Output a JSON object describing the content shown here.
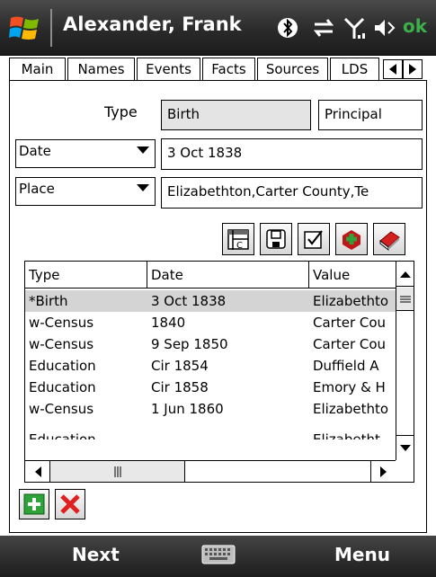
{
  "title_bar": {
    "title": "Alexander, Frank",
    "ok_label": "ok",
    "status_icons": [
      "bluetooth-icon",
      "data-sync-icon",
      "signal-icon",
      "volume-icon"
    ]
  },
  "tabs": [
    {
      "label": "Main"
    },
    {
      "label": "Names"
    },
    {
      "label": "Events",
      "active": true
    },
    {
      "label": "Facts"
    },
    {
      "label": "Sources"
    },
    {
      "label": "LDS"
    }
  ],
  "event_form": {
    "type_label": "Type",
    "type_value": "Birth",
    "role_value": "Principal",
    "date_selector": "Date",
    "date_value": "3 Oct 1838",
    "place_selector": "Place",
    "place_value": "Elizabethton,Carter County,Te"
  },
  "toolbar_icons": [
    "calendar-edit-icon",
    "save-icon",
    "checkbox-icon",
    "add-source-icon",
    "book-icon"
  ],
  "events_list": {
    "columns": [
      "Type",
      "Date",
      "Value"
    ],
    "rows": [
      {
        "type": "*Birth",
        "date": "3 Oct 1838",
        "value": "Elizabethto",
        "selected": true
      },
      {
        "type": "w-Census",
        "date": "1840",
        "value": "Carter Cou"
      },
      {
        "type": "w-Census",
        "date": "9 Sep 1850",
        "value": "Carter Cou"
      },
      {
        "type": "Education",
        "date": "Cir 1854",
        "value": "Duffield A"
      },
      {
        "type": "Education",
        "date": "Cir 1858",
        "value": "Emory & H"
      },
      {
        "type": "w-Census",
        "date": "1 Jun 1860",
        "value": "Elizabethto"
      },
      {
        "type": "Education",
        "date": "",
        "value": "Elizabetht"
      }
    ]
  },
  "actions": {
    "add_icon": "plus-icon",
    "delete_icon": "delete-x-icon"
  },
  "softkeys": {
    "left": "Next",
    "center_icon": "keyboard-icon",
    "right": "Menu"
  },
  "colors": {
    "title_bar_bg": "#2a2a2a",
    "selected_row": "#d4d4d4",
    "ok_green": "#3bb04a",
    "add_green": "#2fa33a",
    "delete_red": "#e02020"
  }
}
